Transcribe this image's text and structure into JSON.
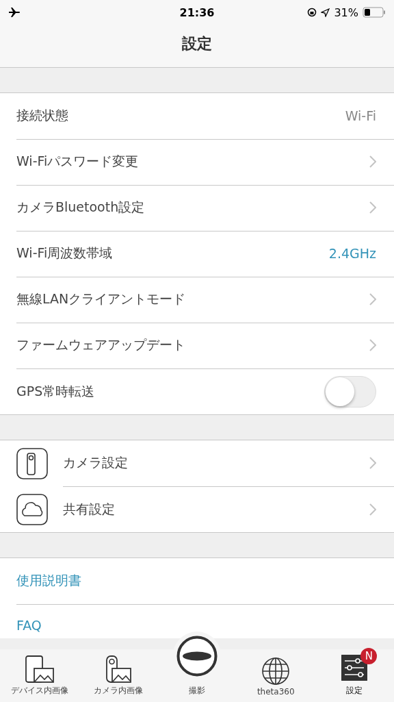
{
  "status_bar": {
    "airplane_mode": true,
    "time": "21:36",
    "battery": "31%"
  },
  "header": {
    "title": "設定"
  },
  "sections": [
    {
      "rows": [
        {
          "kind": "value",
          "label": "接続状態",
          "value": "Wi-Fi"
        },
        {
          "kind": "chevron",
          "label": "Wi-Fiパスワード変更"
        },
        {
          "kind": "chevron",
          "label": "カメラBluetooth設定"
        },
        {
          "kind": "option",
          "label": "Wi-Fi周波数帯域",
          "value": "2.4GHz"
        },
        {
          "kind": "chevron",
          "label": "無線LANクライアントモード"
        },
        {
          "kind": "chevron",
          "label": "ファームウェアアップデート"
        },
        {
          "kind": "toggle",
          "label": "GPS常時転送",
          "on": false
        }
      ]
    },
    {
      "rows": [
        {
          "kind": "icon",
          "label": "カメラ設定"
        },
        {
          "kind": "icon",
          "label": "共有設定"
        }
      ]
    },
    {
      "rows": [
        {
          "kind": "link",
          "label": "使用説明書"
        },
        {
          "kind": "link",
          "label": "FAQ"
        }
      ]
    }
  ],
  "tabs": [
    {
      "label": "デバイス内画像",
      "selected": false
    },
    {
      "label": "カメラ内画像",
      "selected": false
    },
    {
      "label": "撮影",
      "selected": false
    },
    {
      "label": "theta360",
      "selected": false
    },
    {
      "label": "設定",
      "selected": true,
      "badge": "N"
    }
  ]
}
